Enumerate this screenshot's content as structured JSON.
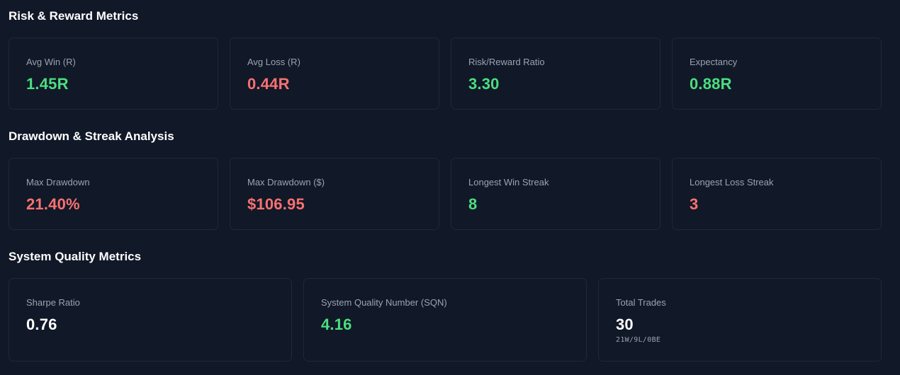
{
  "sections": [
    {
      "title": "Risk & Reward Metrics",
      "cards": [
        {
          "label": "Avg Win (R)",
          "value": "1.45R",
          "tone": "positive"
        },
        {
          "label": "Avg Loss (R)",
          "value": "0.44R",
          "tone": "negative"
        },
        {
          "label": "Risk/Reward Ratio",
          "value": "3.30",
          "tone": "positive"
        },
        {
          "label": "Expectancy",
          "value": "0.88R",
          "tone": "positive"
        }
      ]
    },
    {
      "title": "Drawdown & Streak Analysis",
      "cards": [
        {
          "label": "Max Drawdown",
          "value": "21.40%",
          "tone": "negative"
        },
        {
          "label": "Max Drawdown ($)",
          "value": "$106.95",
          "tone": "negative"
        },
        {
          "label": "Longest Win Streak",
          "value": "8",
          "tone": "positive"
        },
        {
          "label": "Longest Loss Streak",
          "value": "3",
          "tone": "negative"
        }
      ]
    },
    {
      "title": "System Quality Metrics",
      "cards": [
        {
          "label": "Sharpe Ratio",
          "value": "0.76",
          "tone": "neutral"
        },
        {
          "label": "System Quality Number (SQN)",
          "value": "4.16",
          "tone": "positive"
        },
        {
          "label": "Total Trades",
          "value": "30",
          "tone": "neutral",
          "sub": "21W/9L/0BE"
        }
      ]
    }
  ],
  "colors": {
    "background": "#111827",
    "card_border": "#1f2937",
    "positive": "#4ade80",
    "negative": "#f87171",
    "neutral": "#ffffff",
    "label": "#9ca3af"
  }
}
